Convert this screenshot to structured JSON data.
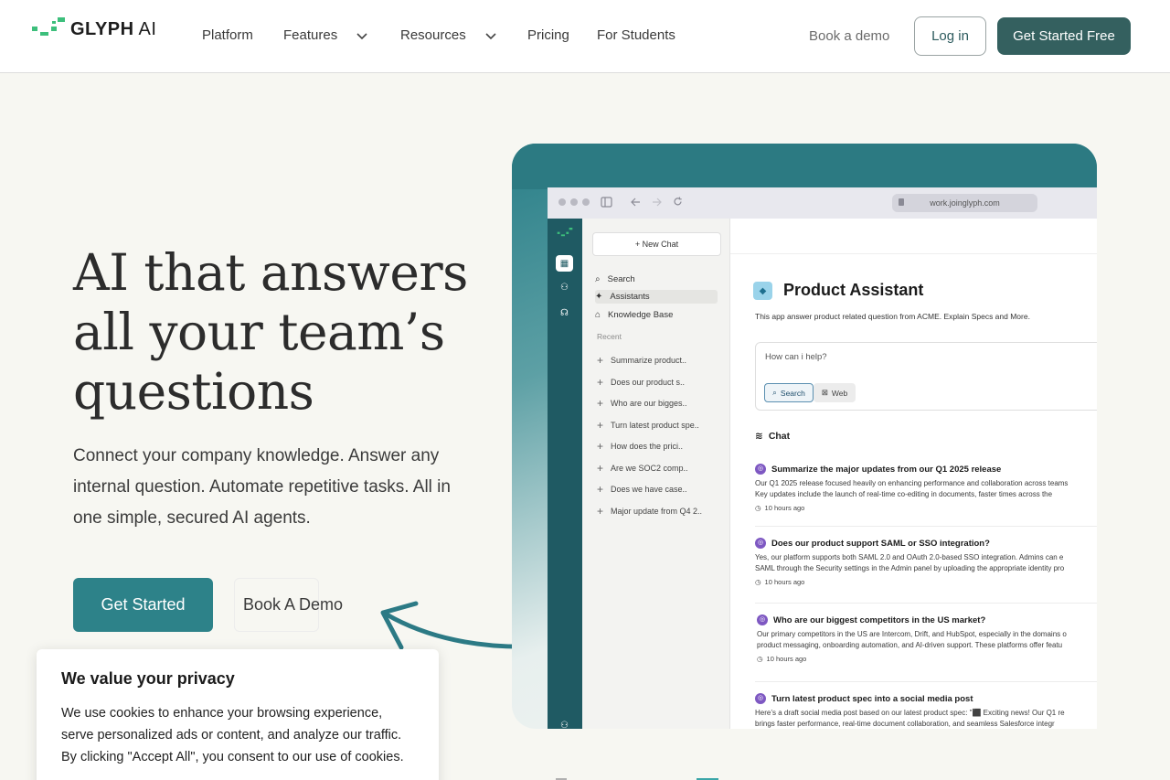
{
  "nav": {
    "logo_text_bold": "GLYPH",
    "logo_text_light": " AI",
    "items": [
      {
        "label": "Platform"
      },
      {
        "label": "Features",
        "icon": "chevron-down-icon"
      },
      {
        "label": "Resources",
        "icon": "chevron-down-icon"
      },
      {
        "label": "Pricing"
      },
      {
        "label": "For Students"
      }
    ],
    "book_demo": "Book a demo",
    "login": "Log in",
    "get_started_free": "Get Started Free"
  },
  "hero": {
    "title_line1": "AI that answers",
    "title_line2": "all your team’s",
    "title_line3": "questions",
    "subtitle": "Connect your company knowledge. Answer any internal question. Automate repetitive tasks. All in one simple, secured AI agents.",
    "cta_primary": "Get Started",
    "cta_secondary": "Book A Demo"
  },
  "cookie": {
    "title": "We value your privacy",
    "text": "We use cookies to enhance your browsing experience, serve personalized ads or content, and analyze our traffic. By clicking \"Accept All\", you consent to our use of cookies."
  },
  "preview": {
    "url": "work.joinglyph.com",
    "new_chat": "+ New Chat",
    "side_links": [
      "Search",
      "Assistants",
      "Knowledge Base"
    ],
    "recent_label": "Recent",
    "recent_items": [
      "Summarize product..",
      "Does our product s..",
      "Who are our bigges..",
      "Turn latest product spe..",
      "How does the prici..",
      "Are we SOC2 comp..",
      "Does we have case..",
      "Major update from Q4 2.."
    ],
    "assistant_title": "Product Assistant",
    "assistant_desc": "This app answer product related question from ACME. Explain Specs and More.",
    "ask_placeholder": "How can i help?",
    "toggle_search": "Search",
    "toggle_web": "Web",
    "chat_label": "Chat",
    "chats": [
      {
        "q": "Summarize the major updates from our Q1 2025 release",
        "a1": "Our Q1 2025 release focused heavily on enhancing performance and collaboration across teams",
        "a2": "Key updates include the launch of real-time co-editing in documents, faster times across the",
        "time": "10 hours ago"
      },
      {
        "q": "Does our product support SAML or SSO integration?",
        "a1": "Yes, our platform supports both SAML 2.0 and OAuth 2.0-based SSO integration. Admins can e",
        "a2": "SAML through the Security settings in the Admin panel by uploading the appropriate identity pro",
        "time": "10 hours ago"
      },
      {
        "q": "Who are our biggest competitors in the US market?",
        "a1": "Our primary competitors in the US are Intercom, Drift, and HubSpot, especially in the domains o",
        "a2": "product messaging, onboarding automation, and AI-driven support. These platforms offer featu",
        "time": "10 hours ago"
      },
      {
        "q": "Turn latest product spec into a social media post",
        "a1": "Here’s a draft social media post based on our latest product spec: \"⬛ Exciting news! Our Q1 re",
        "a2": "brings faster performance, real-time document collaboration, and seamless Salesforce integr",
        "time": ""
      }
    ]
  },
  "colors": {
    "brand_teal": "#2d8289",
    "brand_dark": "#34605f",
    "logo_green": "#3dbf7c",
    "rail": "#1f5a63"
  }
}
